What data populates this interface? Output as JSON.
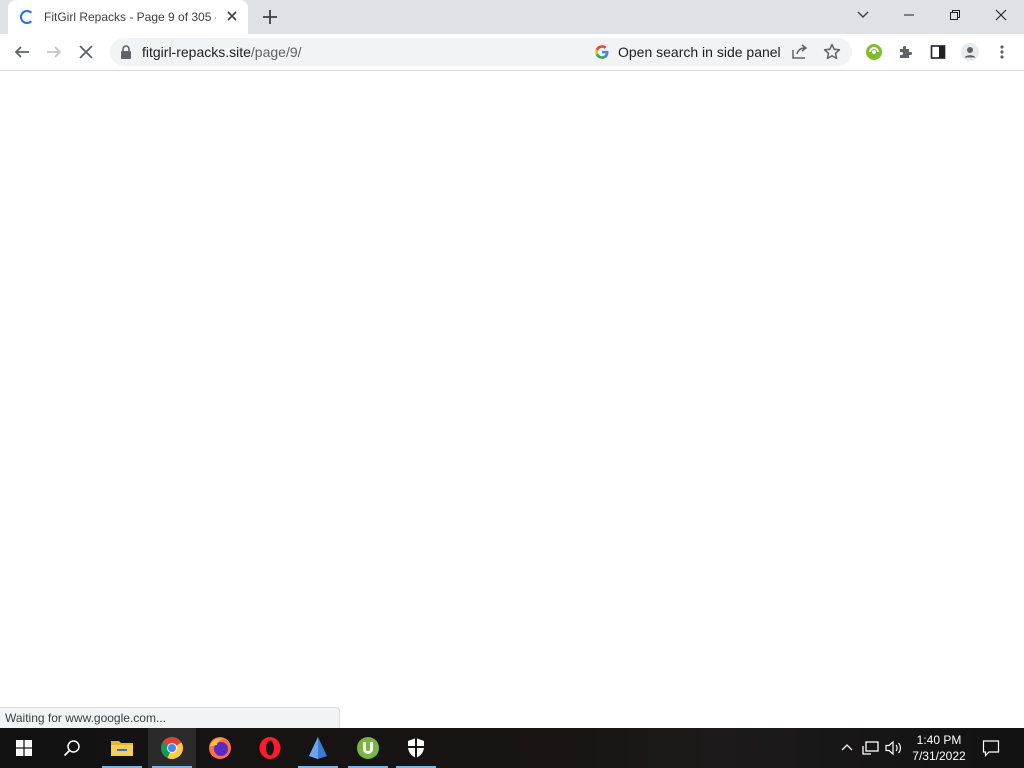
{
  "browser": {
    "tab": {
      "title": "FitGirl Repacks - Page 9 of 305 -"
    },
    "omnibox": {
      "domain": "fitgirl-repacks.site",
      "path": "/page/9/"
    },
    "side_panel": {
      "label": "Open search in side panel"
    },
    "status": "Waiting for www.google.com..."
  },
  "taskbar": {
    "time": "1:40 PM",
    "date": "7/31/2022"
  },
  "colors": {
    "accent": "#1a73e8",
    "tabstrip": "#dee1e6",
    "taskbar": "#141414"
  }
}
